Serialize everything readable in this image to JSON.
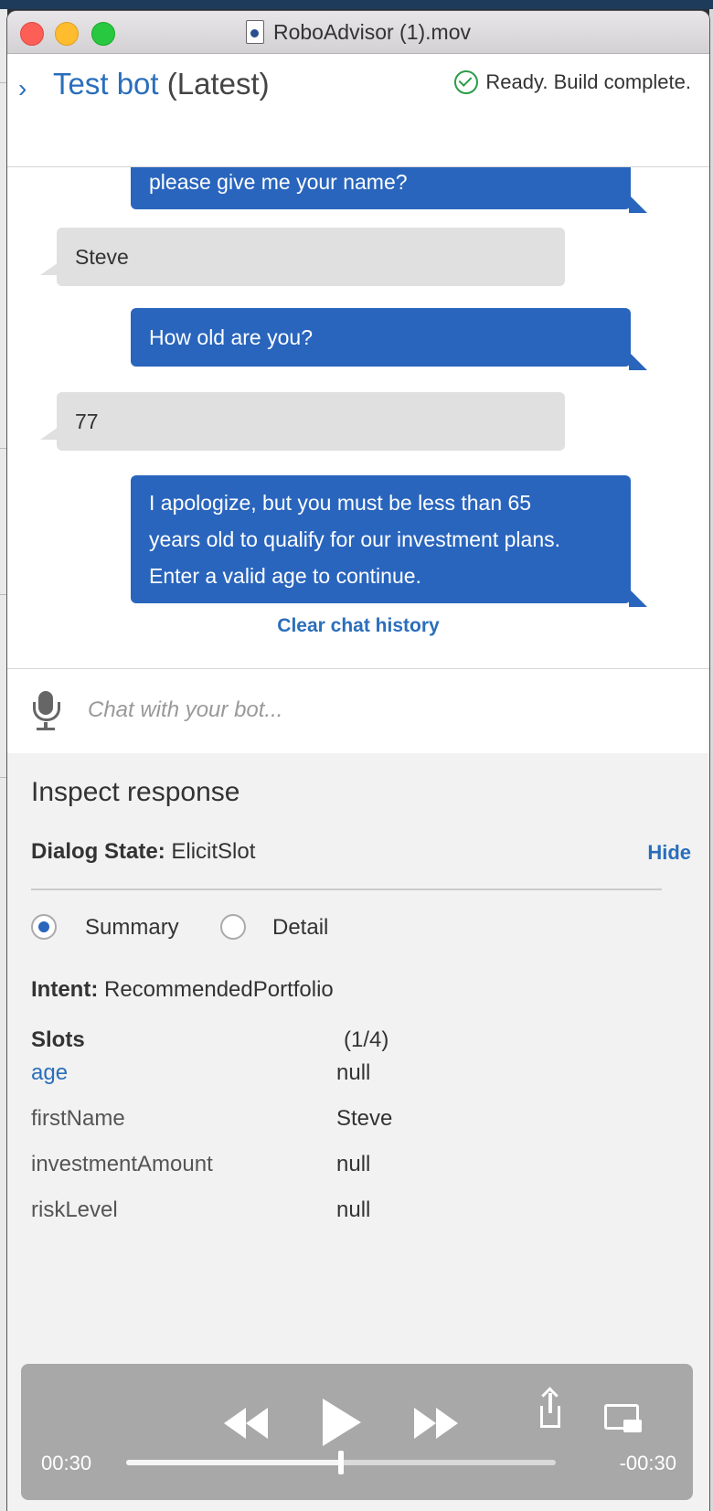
{
  "window": {
    "title": "RoboAdvisor (1).mov"
  },
  "header": {
    "title": "Test bot",
    "version": "(Latest)",
    "status": "Ready. Build complete."
  },
  "chat": {
    "messages": [
      {
        "sender": "bot",
        "text": "please give me your name?"
      },
      {
        "sender": "user",
        "text": "Steve"
      },
      {
        "sender": "bot",
        "text": "How old are you?"
      },
      {
        "sender": "user",
        "text": "77"
      },
      {
        "sender": "bot",
        "lines": [
          "I apologize, but you must be less than 65",
          "years old to qualify for our investment plans.",
          "Enter a valid age to continue."
        ]
      }
    ],
    "clear_label": "Clear chat history",
    "input_placeholder": "Chat with your bot..."
  },
  "inspect": {
    "title": "Inspect response",
    "dialog_state_label": "Dialog State:",
    "dialog_state_value": "ElicitSlot",
    "hide_label": "Hide",
    "radio_summary": "Summary",
    "radio_detail": "Detail",
    "intent_label": "Intent:",
    "intent_value": "RecommendedPortfolio",
    "slots_label": "Slots",
    "slots_count": "(1/4)",
    "slots": [
      {
        "name": "age",
        "value": "null"
      },
      {
        "name": "firstName",
        "value": "Steve"
      },
      {
        "name": "investmentAmount",
        "value": "null"
      },
      {
        "name": "riskLevel",
        "value": "null"
      }
    ]
  },
  "player": {
    "elapsed": "00:30",
    "remaining": "-00:30",
    "progress": 0.5
  }
}
